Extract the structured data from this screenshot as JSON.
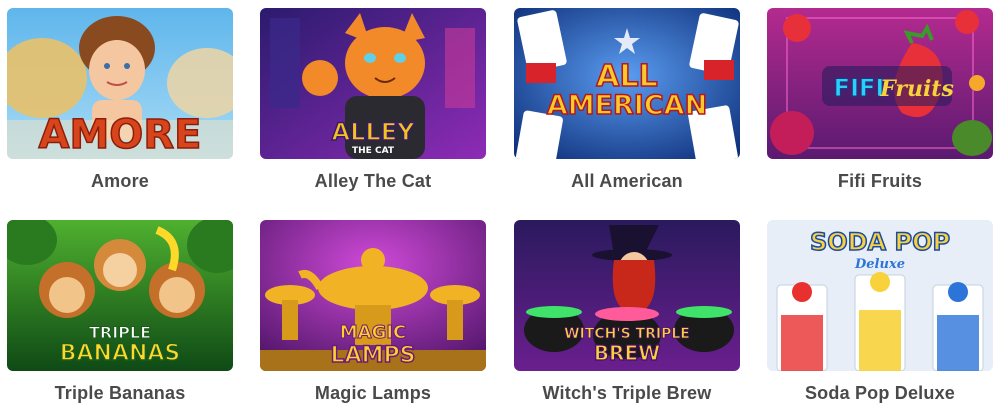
{
  "games": [
    {
      "title": "Amore",
      "logo_text": "AMORE",
      "thumbnail": "cherub-with-golden-wings",
      "colors": {
        "bg_top": "#5fb6ec",
        "bg_bottom": "#9fd7f4",
        "logo": "#d8451c",
        "accent": "#e8c169"
      }
    },
    {
      "title": "Alley The Cat",
      "logo_text": "ALLEY",
      "logo_subtext": "THE CAT",
      "thumbnail": "orange-cat-in-leather-jacket",
      "colors": {
        "bg_top": "#2b1b6e",
        "bg_bottom": "#8e2bb6",
        "logo": "#f6c21c",
        "accent": "#f28a2a"
      }
    },
    {
      "title": "All American",
      "logo_text_line1": "ALL",
      "logo_text_line2": "AMERICAN",
      "thumbnail": "stars-and-stripes-playing-cards",
      "colors": {
        "bg_top": "#1d5fd0",
        "bg_bottom": "#0e2f7a",
        "logo": "#f7c92a",
        "accent": "#d8232a"
      }
    },
    {
      "title": "Fifi Fruits",
      "logo_text_line1": "FIFI",
      "logo_text_line2": "Fruits",
      "thumbnail": "strawberry-and-cherries-neon",
      "colors": {
        "bg_top": "#b42a8f",
        "bg_bottom": "#5a1a70",
        "logo": "#2ad0f5",
        "accent": "#e8303a"
      }
    },
    {
      "title": "Triple Bananas",
      "logo_text_line1": "TRIPLE",
      "logo_text_line2": "BANANAS",
      "thumbnail": "three-monkeys-in-jungle",
      "colors": {
        "bg_top": "#2f8d2b",
        "bg_bottom": "#0f4a16",
        "logo": "#ffd92a",
        "accent": "#d48a3a"
      }
    },
    {
      "title": "Magic Lamps",
      "logo_text_line1": "MAGIC",
      "logo_text_line2": "LAMPS",
      "thumbnail": "golden-genie-lamps",
      "colors": {
        "bg_top": "#8a2bb0",
        "bg_bottom": "#4d1466",
        "logo": "#ffcf2e",
        "accent": "#f2b226"
      }
    },
    {
      "title": "Witch's Triple Brew",
      "logo_text_line1": "WITCH'S TRIPLE",
      "logo_text_line2": "BREW",
      "thumbnail": "witch-with-bubbling-cauldrons",
      "colors": {
        "bg_top": "#2a1a5e",
        "bg_bottom": "#6a1f8e",
        "logo": "#f7d23a",
        "accent": "#3fe36a"
      }
    },
    {
      "title": "Soda Pop Deluxe",
      "logo_text_line1": "SODA POP",
      "logo_text_line2": "Deluxe",
      "thumbnail": "soda-fountain-machines",
      "colors": {
        "bg_top": "#f4f6fb",
        "bg_bottom": "#d9e4f2",
        "logo": "#2d74d8",
        "accent": "#e8302e"
      }
    }
  ]
}
